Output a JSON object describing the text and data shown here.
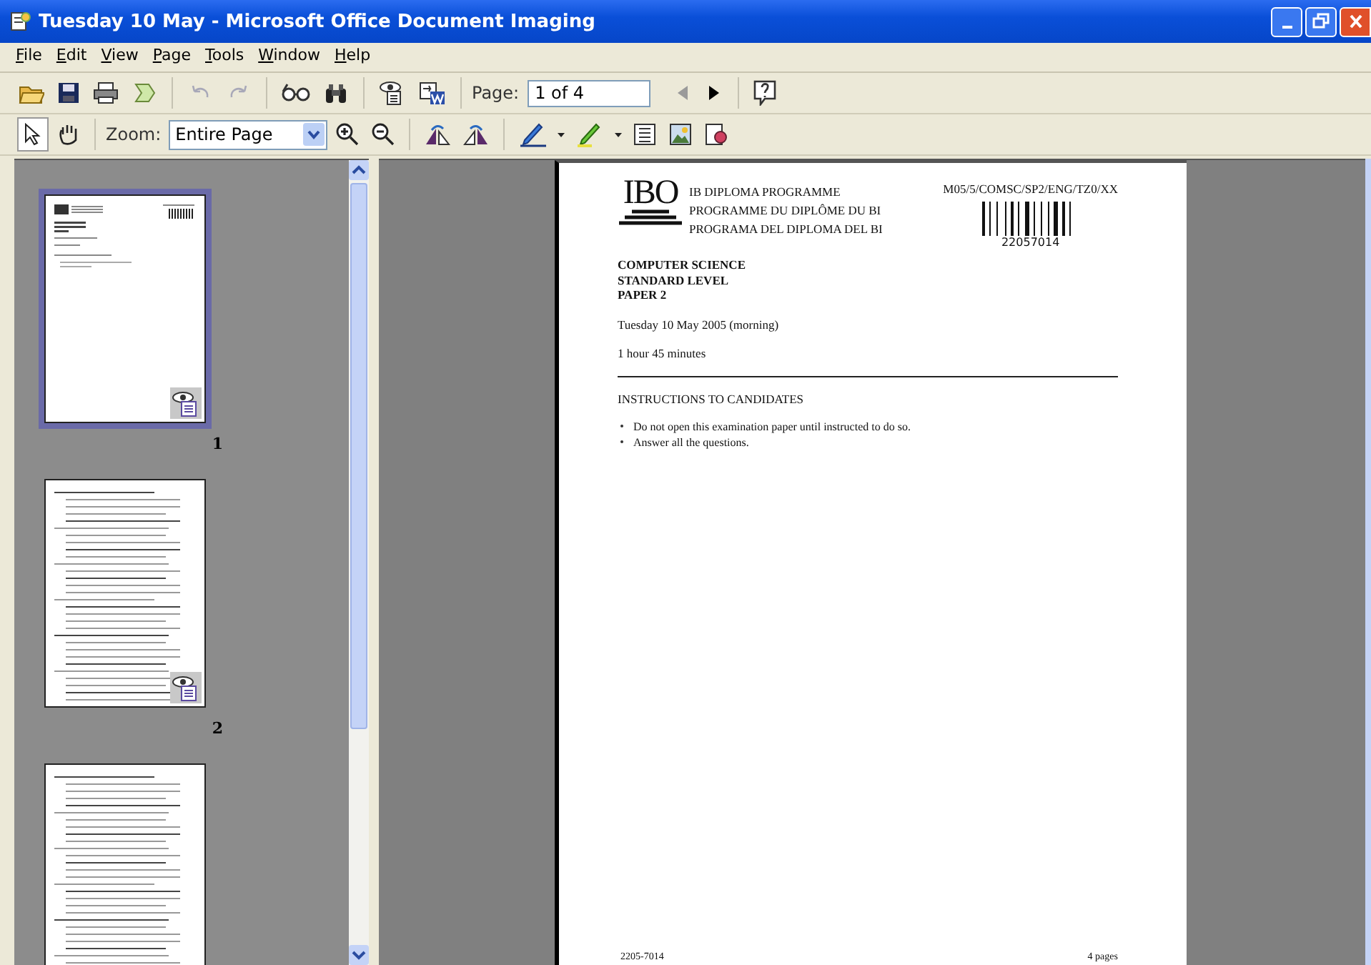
{
  "window": {
    "title": "Tuesday 10 May - Microsoft Office Document Imaging"
  },
  "menu": [
    "File",
    "Edit",
    "View",
    "Page",
    "Tools",
    "Window",
    "Help"
  ],
  "standard_toolbar": {
    "undo": {
      "disabled": true
    },
    "redo": {
      "disabled": true
    },
    "page_label": "Page:",
    "page_field": "1 of 4",
    "previous_page": {
      "disabled": true
    },
    "next_page": {
      "disabled": false
    }
  },
  "annotation_toolbar": {
    "select_tool": {
      "selected": true
    },
    "pan_tool": {
      "selected": false
    },
    "zoom_label": "Zoom:",
    "zoom_value": "Entire Page"
  },
  "thumbnails": [
    {
      "label": "1",
      "kind": "cover",
      "selected": true,
      "badge": true
    },
    {
      "label": "2",
      "kind": "questions",
      "selected": false,
      "badge": true
    },
    {
      "kind": "questions",
      "selected": false,
      "badge": false
    }
  ],
  "document": {
    "logo": "IBO",
    "programme_lines": [
      "IB DIPLOMA PROGRAMME",
      "PROGRAMME DU DIPLÔME DU BI",
      "PROGRAMA DEL DIPLOMA DEL BI"
    ],
    "reference": "M05/5/COMSC/SP2/ENG/TZ0/XX",
    "barcode_number": "22057014",
    "subject_lines": [
      "COMPUTER SCIENCE",
      "STANDARD LEVEL",
      "PAPER 2"
    ],
    "date": "Tuesday 10 May 2005 (morning)",
    "duration": "1 hour 45 minutes",
    "instructions_heading": "INSTRUCTIONS TO CANDIDATES",
    "instructions": [
      "Do not open this examination paper until instructed to do so.",
      "Answer all the questions."
    ],
    "footer_left": "2205-7014",
    "footer_right": "4 pages"
  }
}
